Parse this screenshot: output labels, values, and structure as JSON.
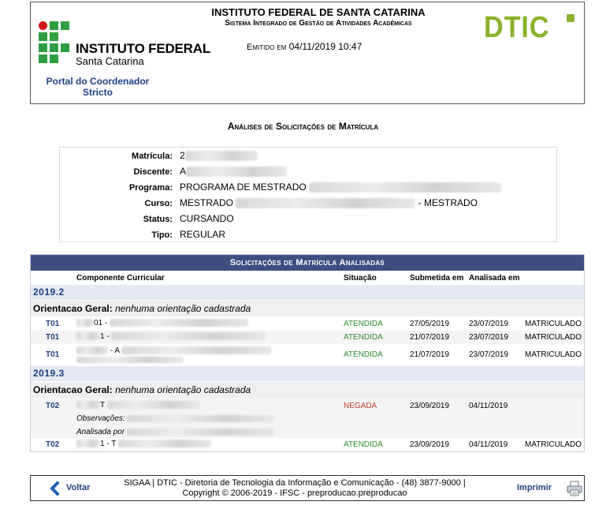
{
  "header": {
    "institution_title": "INSTITUTO FEDERAL",
    "institution_subtitle": "Santa Catarina",
    "portal_line1": "Portal do Coordenador",
    "portal_line2": "Stricto",
    "center_line1": "INSTITUTO FEDERAL DE SANTA CATARINA",
    "center_line2": "Sistema Integrado de Gestão de Atividades Acadêmicas",
    "emitido_label": "Emitido em",
    "emitido_value": "04/11/2019 10:47",
    "dtic_logo": "DTIC"
  },
  "page_title": "Análises de Solicitações de Matrícula",
  "info": {
    "matricula_label": "Matrícula:",
    "matricula_value": "2",
    "discente_label": "Discente:",
    "discente_value": "A",
    "programa_label": "Programa:",
    "programa_value": "PROGRAMA DE MESTRADO",
    "curso_label": "Curso:",
    "curso_value": "MESTRADO",
    "curso_suffix": "- MESTRADO",
    "status_label": "Status:",
    "status_value": "CURSANDO",
    "tipo_label": "Tipo:",
    "tipo_value": "REGULAR"
  },
  "table": {
    "caption": "Solicitações de Matrícula Analisadas",
    "headers": {
      "componente": "Componente Curricular",
      "situacao": "Situação",
      "submetida": "Submetida em",
      "analisada": "Analisada em"
    },
    "groups": [
      {
        "year": "2019.2",
        "orient_label": "Orientacao Geral:",
        "orient_value": "nenhuma orientação cadastrada",
        "rows": [
          {
            "code": "T01",
            "comp": "01 -",
            "situacao": "ATENDIDA",
            "submetida": "27/05/2019",
            "analisada": "23/07/2019",
            "status": "MATRICULADO"
          },
          {
            "code": "T01",
            "comp": "1 -",
            "situacao": "ATENDIDA",
            "submetida": "21/07/2019",
            "analisada": "23/07/2019",
            "status": "MATRICULADO"
          },
          {
            "code": "T01",
            "comp": "- A",
            "situacao": "ATENDIDA",
            "submetida": "21/07/2019",
            "analisada": "23/07/2019",
            "status": "MATRICULADO"
          }
        ]
      },
      {
        "year": "2019.3",
        "orient_label": "Orientacao Geral:",
        "orient_value": "nenhuma orientação cadastrada",
        "rows": [
          {
            "code": "T02",
            "comp": "T",
            "situacao": "NEGADA",
            "submetida": "23/09/2019",
            "analisada": "04/11/2019",
            "status": "",
            "obs_label": "Observações:",
            "analisada_por_label": "Analisada por"
          },
          {
            "code": "T02",
            "comp": "1 - T",
            "situacao": "ATENDIDA",
            "submetida": "23/09/2019",
            "analisada": "04/11/2019",
            "status": "MATRICULADO"
          }
        ]
      }
    ]
  },
  "footer": {
    "voltar": "Voltar",
    "line1": "SIGAA | DTIC - Diretoria de Tecnologia da Informação e Comunicação - (48) 3877-9000 |",
    "line2": "Copyright © 2006-2019 - IFSC - preproducao.preproducao",
    "imprimir": "Imprimir"
  },
  "colors": {
    "ifsc_green": "#2f9e41",
    "ifsc_red": "#cd191e",
    "dtic_green": "#8ab22a",
    "caption_bg": "#3c4f80",
    "link_blue": "#1d3e85",
    "status_ok": "#2e8b2e",
    "status_denied": "#c0392b"
  },
  "icons": [
    "back-arrow-icon",
    "printer-icon",
    "ifsc-logo-icon",
    "dtic-logo-icon"
  ]
}
